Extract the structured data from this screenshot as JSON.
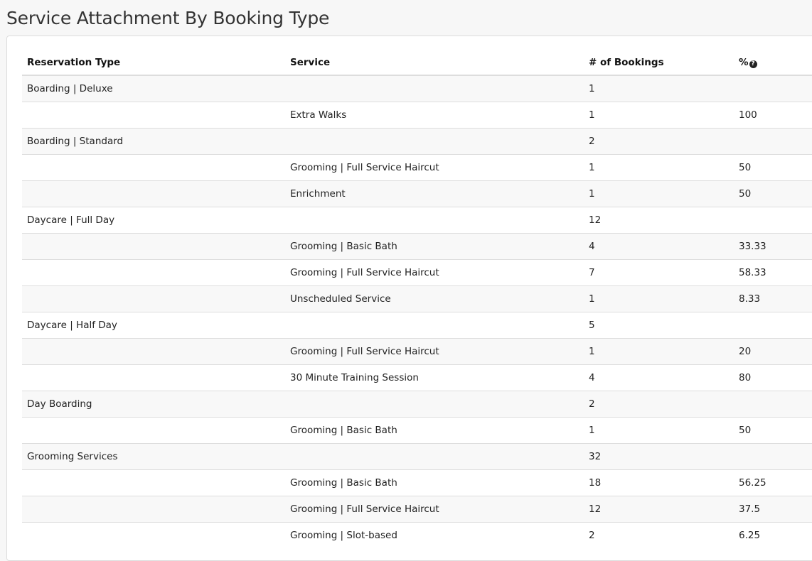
{
  "page": {
    "title": "Service Attachment By Booking Type"
  },
  "table": {
    "headers": {
      "reservation_type": "Reservation Type",
      "service": "Service",
      "bookings": "# of Bookings",
      "percent": "%"
    },
    "help_icon": "question-circle-icon",
    "rows": [
      {
        "reservation_type": "Boarding | Deluxe",
        "service": "",
        "bookings": "1",
        "percent": ""
      },
      {
        "reservation_type": "",
        "service": "Extra Walks",
        "bookings": "1",
        "percent": "100"
      },
      {
        "reservation_type": "Boarding | Standard",
        "service": "",
        "bookings": "2",
        "percent": ""
      },
      {
        "reservation_type": "",
        "service": "Grooming | Full Service Haircut",
        "bookings": "1",
        "percent": "50"
      },
      {
        "reservation_type": "",
        "service": "Enrichment",
        "bookings": "1",
        "percent": "50"
      },
      {
        "reservation_type": "Daycare | Full Day",
        "service": "",
        "bookings": "12",
        "percent": ""
      },
      {
        "reservation_type": "",
        "service": "Grooming | Basic Bath",
        "bookings": "4",
        "percent": "33.33"
      },
      {
        "reservation_type": "",
        "service": "Grooming | Full Service Haircut",
        "bookings": "7",
        "percent": "58.33"
      },
      {
        "reservation_type": "",
        "service": "Unscheduled Service",
        "bookings": "1",
        "percent": "8.33"
      },
      {
        "reservation_type": "Daycare | Half Day",
        "service": "",
        "bookings": "5",
        "percent": ""
      },
      {
        "reservation_type": "",
        "service": "Grooming | Full Service Haircut",
        "bookings": "1",
        "percent": "20"
      },
      {
        "reservation_type": "",
        "service": "30 Minute Training Session",
        "bookings": "4",
        "percent": "80"
      },
      {
        "reservation_type": "Day Boarding",
        "service": "",
        "bookings": "2",
        "percent": ""
      },
      {
        "reservation_type": "",
        "service": "Grooming | Basic Bath",
        "bookings": "1",
        "percent": "50"
      },
      {
        "reservation_type": "Grooming Services",
        "service": "",
        "bookings": "32",
        "percent": ""
      },
      {
        "reservation_type": "",
        "service": "Grooming | Basic Bath",
        "bookings": "18",
        "percent": "56.25"
      },
      {
        "reservation_type": "",
        "service": "Grooming | Full Service Haircut",
        "bookings": "12",
        "percent": "37.5"
      },
      {
        "reservation_type": "",
        "service": "Grooming | Slot-based",
        "bookings": "2",
        "percent": "6.25"
      }
    ]
  }
}
